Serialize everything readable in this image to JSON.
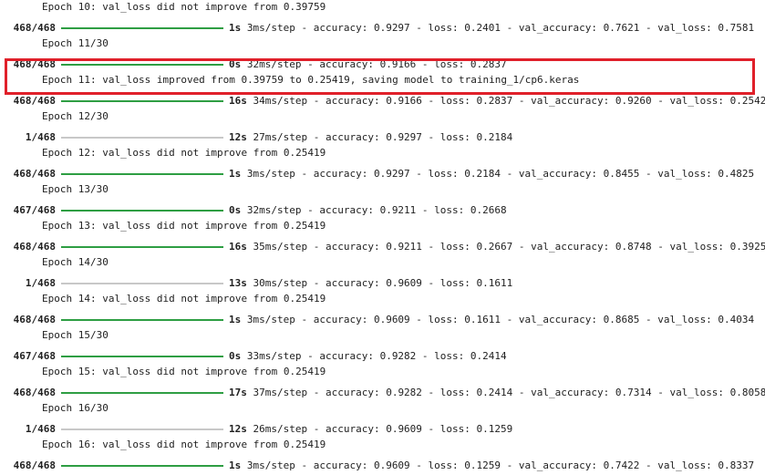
{
  "colors": {
    "bar_fill": "#2e9e43",
    "bar_track": "#c8c8c8",
    "highlight": "#e0202a"
  },
  "lines": [
    {
      "type": "text",
      "text": "Epoch 10: val_loss did not improve from 0.39759"
    },
    {
      "type": "progress",
      "count": "468/468",
      "progress": 1.0,
      "time": "1s",
      "rest": "3ms/step - accuracy: 0.9297 - loss: 0.2401 - val_accuracy: 0.7621 - val_loss: 0.7581"
    },
    {
      "type": "text",
      "text": "Epoch 11/30"
    },
    {
      "type": "progress",
      "count": "468/468",
      "progress": 1.0,
      "time": "0s",
      "rest": "32ms/step - accuracy: 0.9166 - loss: 0.2837"
    },
    {
      "type": "text",
      "text": "Epoch 11: val_loss improved from 0.39759 to 0.25419, saving model to training_1/cp6.keras"
    },
    {
      "type": "progress",
      "count": "468/468",
      "progress": 1.0,
      "time": "16s",
      "rest": "34ms/step - accuracy: 0.9166 - loss: 0.2837 - val_accuracy: 0.9260 - val_loss: 0.2542"
    },
    {
      "type": "text",
      "text": "Epoch 12/30"
    },
    {
      "type": "progress",
      "count": "1/468",
      "progress": 0.0,
      "time": "12s",
      "rest": "27ms/step - accuracy: 0.9297 - loss: 0.2184"
    },
    {
      "type": "text",
      "text": "Epoch 12: val_loss did not improve from 0.25419"
    },
    {
      "type": "progress",
      "count": "468/468",
      "progress": 1.0,
      "time": "1s",
      "rest": "3ms/step - accuracy: 0.9297 - loss: 0.2184 - val_accuracy: 0.8455 - val_loss: 0.4825"
    },
    {
      "type": "text",
      "text": "Epoch 13/30"
    },
    {
      "type": "progress",
      "count": "467/468",
      "progress": 0.998,
      "time": "0s",
      "rest": "32ms/step - accuracy: 0.9211 - loss: 0.2668"
    },
    {
      "type": "text",
      "text": "Epoch 13: val_loss did not improve from 0.25419"
    },
    {
      "type": "progress",
      "count": "468/468",
      "progress": 1.0,
      "time": "16s",
      "rest": "35ms/step - accuracy: 0.9211 - loss: 0.2667 - val_accuracy: 0.8748 - val_loss: 0.3925"
    },
    {
      "type": "text",
      "text": "Epoch 14/30"
    },
    {
      "type": "progress",
      "count": "1/468",
      "progress": 0.0,
      "time": "13s",
      "rest": "30ms/step - accuracy: 0.9609 - loss: 0.1611"
    },
    {
      "type": "text",
      "text": "Epoch 14: val_loss did not improve from 0.25419"
    },
    {
      "type": "progress",
      "count": "468/468",
      "progress": 1.0,
      "time": "1s",
      "rest": "3ms/step - accuracy: 0.9609 - loss: 0.1611 - val_accuracy: 0.8685 - val_loss: 0.4034"
    },
    {
      "type": "text",
      "text": "Epoch 15/30"
    },
    {
      "type": "progress",
      "count": "467/468",
      "progress": 0.998,
      "time": "0s",
      "rest": "33ms/step - accuracy: 0.9282 - loss: 0.2414"
    },
    {
      "type": "text",
      "text": "Epoch 15: val_loss did not improve from 0.25419"
    },
    {
      "type": "progress",
      "count": "468/468",
      "progress": 1.0,
      "time": "17s",
      "rest": "37ms/step - accuracy: 0.9282 - loss: 0.2414 - val_accuracy: 0.7314 - val_loss: 0.8058"
    },
    {
      "type": "text",
      "text": "Epoch 16/30"
    },
    {
      "type": "progress",
      "count": "1/468",
      "progress": 0.0,
      "time": "12s",
      "rest": "26ms/step - accuracy: 0.9609 - loss: 0.1259"
    },
    {
      "type": "text",
      "text": "Epoch 16: val_loss did not improve from 0.25419"
    },
    {
      "type": "progress",
      "count": "468/468",
      "progress": 1.0,
      "time": "1s",
      "rest": "3ms/step - accuracy: 0.9609 - loss: 0.1259 - val_accuracy: 0.7422 - val_loss: 0.8337"
    }
  ]
}
